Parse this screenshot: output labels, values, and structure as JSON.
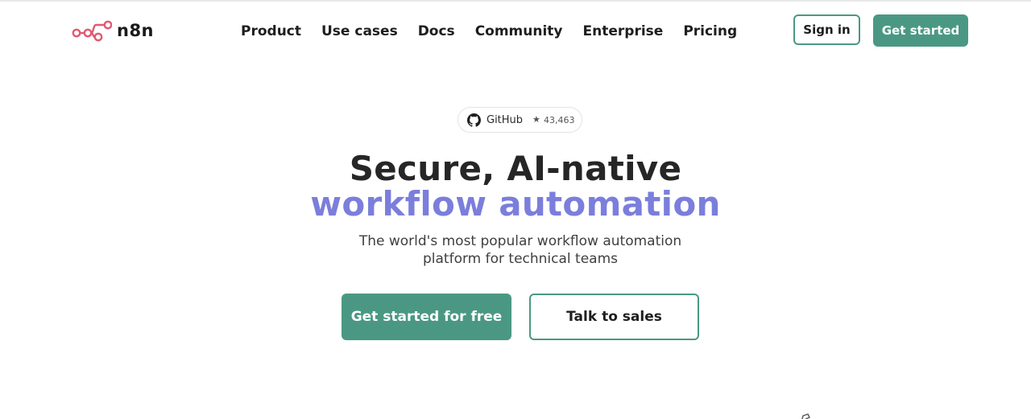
{
  "brand": {
    "name": "n8n",
    "logo_icon": "n8n-logo-icon",
    "accent_color": "#4a9883",
    "logo_color": "#e05a71",
    "headline_accent_color": "#7b7edb"
  },
  "nav": {
    "items": [
      {
        "label": "Product"
      },
      {
        "label": "Use cases"
      },
      {
        "label": "Docs"
      },
      {
        "label": "Community"
      },
      {
        "label": "Enterprise"
      },
      {
        "label": "Pricing"
      }
    ],
    "sign_in_label": "Sign in",
    "get_started_label": "Get started"
  },
  "github": {
    "icon": "github-icon",
    "label": "GitHub",
    "star_icon": "★",
    "stars": "43,463"
  },
  "hero": {
    "title_line1": "Secure, AI-native",
    "title_line2": "workflow automation",
    "subtitle": "The world's most popular workflow automation platform for technical teams",
    "primary_cta": "Get started for free",
    "secondary_cta": "Talk to sales"
  }
}
